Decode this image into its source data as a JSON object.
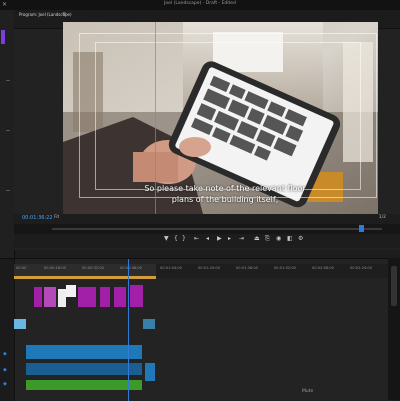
{
  "app": {
    "window_title": "Joel (Landscape) - Draft - Edited"
  },
  "program_monitor": {
    "tab_label": "Program: Joel (Landscape)",
    "subtitle_line1": "So please take note of the relevant floor",
    "subtitle_line2": "plans of the building itself,",
    "timecode": "00:01:36:22",
    "fit_label": "Fit",
    "resolution_label": "1/2",
    "transport_icons": [
      "marker-icon",
      "mark-in-icon",
      "mark-out-icon",
      "go-to-in-icon",
      "step-back-icon",
      "play-icon",
      "step-forward-icon",
      "go-to-out-icon",
      "lift-icon",
      "extract-icon",
      "export-frame-icon",
      "compare-icon",
      "settings-icon"
    ]
  },
  "timeline": {
    "ruler_labels": [
      "00:00",
      "00:00:16:00",
      "00:00:32:00",
      "00:00:48:00",
      "00:01:04:00",
      "00:01:20:00",
      "00:01:36:00",
      "00:01:52:00",
      "00:02:08:00",
      "00:02:24:00"
    ],
    "bottom_label": "Mute",
    "colors": {
      "video_clip": "#a21fa8",
      "audio_clip": "#1f78b7",
      "music_clip": "#3b9a2a",
      "playhead": "#2f7bd8",
      "work_area": "#d39c3a"
    }
  }
}
